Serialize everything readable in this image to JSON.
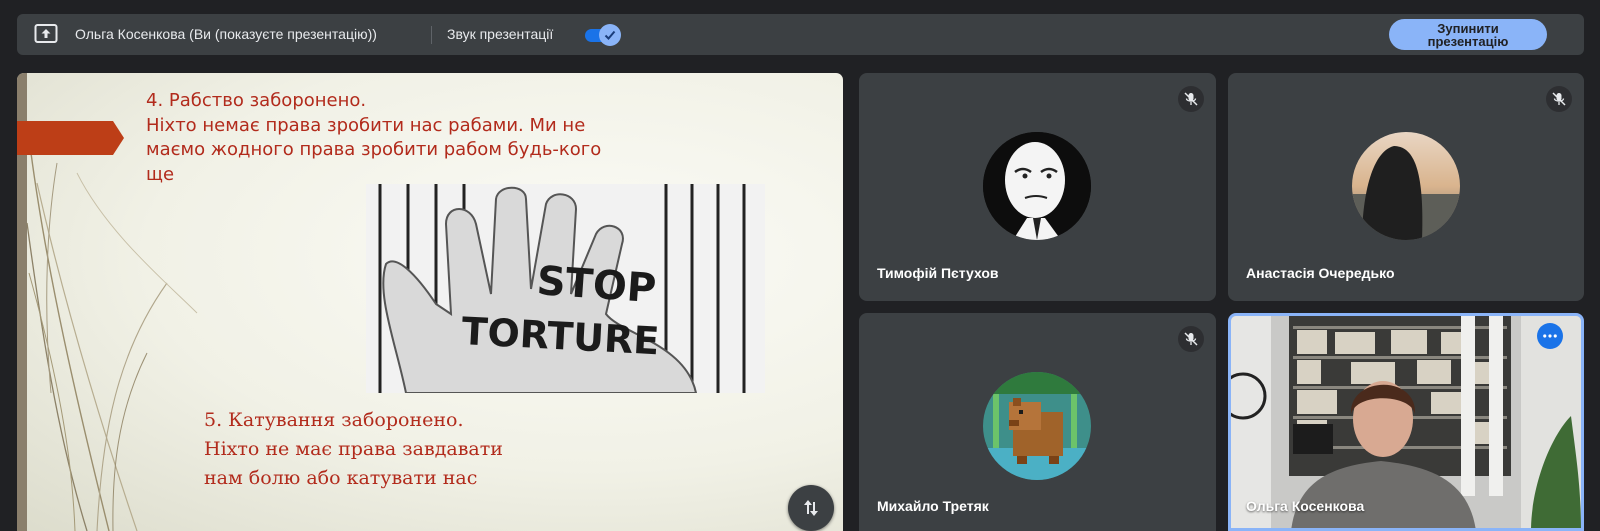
{
  "top_bar": {
    "presenter_label": "Ольга Косенкова (Ви (показуєте презентацію))",
    "sound_label": "Звук презентації",
    "sound_enabled": true,
    "stop_button_label": "Зупинити презентацію"
  },
  "slide": {
    "text_block_1": "4. Рабство заборонено.\nНіхто немає права зробити нас рабами. Ми не маємо жодного права зробити рабом будь-кого ще",
    "text_block_2": "5. Катування заборонено.\nНіхто не має права завдавати нам болю або катувати нас",
    "photo_words": [
      "STOP",
      "TORTURE"
    ],
    "text_color": "#b22b1c"
  },
  "participants": [
    {
      "name": "Тимофій Пєтухов",
      "muted": true,
      "avatar": "meme-face-avatar"
    },
    {
      "name": "Анастасія Очередько",
      "muted": true,
      "avatar": "sunset-photo-avatar"
    },
    {
      "name": "Михайло Третяк",
      "muted": true,
      "avatar": "pixel-capybara-avatar"
    },
    {
      "name": "Ольга Косенкова",
      "muted": false,
      "avatar": "camera-video",
      "active_speaker": true
    }
  ],
  "icons": {
    "present": "present-screen-icon",
    "mic_off": "mic-off-icon",
    "more": "more-options-icon",
    "swap": "swap-layout-icon"
  },
  "colors": {
    "background": "#202124",
    "surface": "#3c4043",
    "accent": "#8ab4f8",
    "active_border": "#8ab4f8"
  }
}
